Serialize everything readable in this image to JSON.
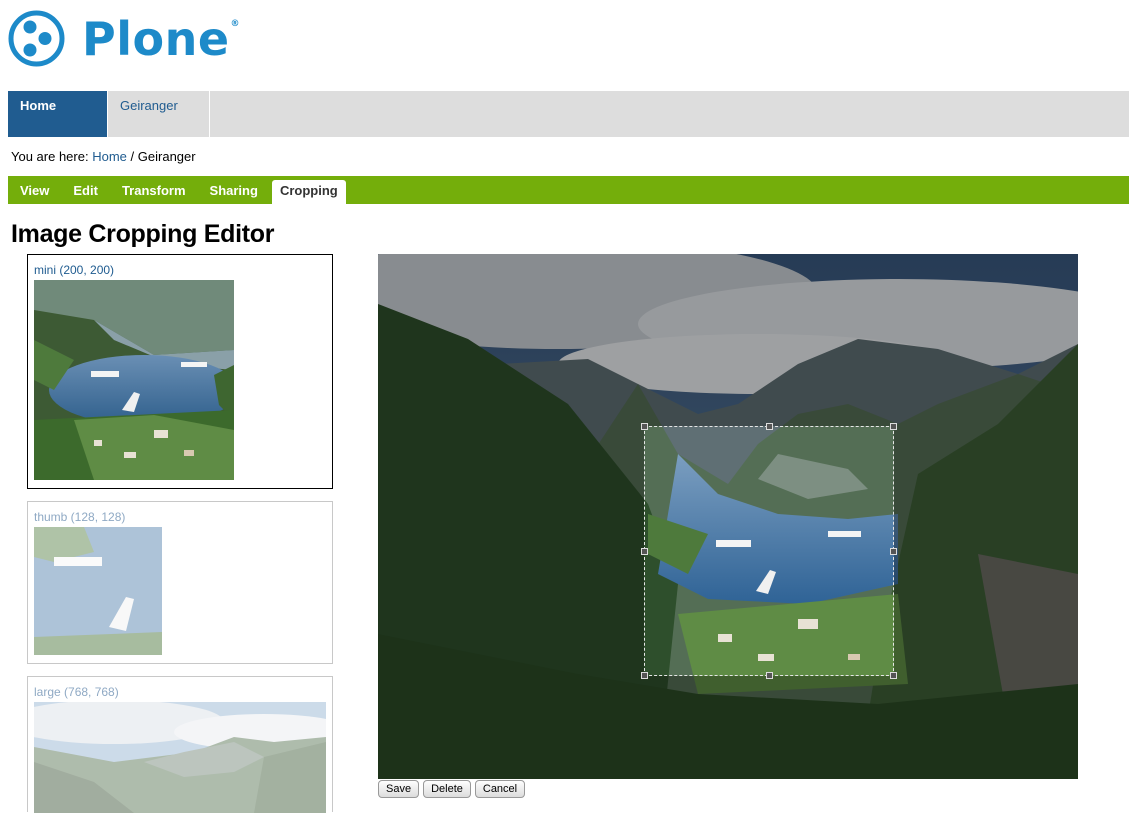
{
  "logo": {
    "text": "Plone",
    "reg": "®"
  },
  "portal_tabs": [
    {
      "label": "Home"
    },
    {
      "label": "Geiranger"
    }
  ],
  "breadcrumb": {
    "prefix": "You are here:",
    "home": "Home",
    "separator": "/",
    "current": "Geiranger"
  },
  "content_tabs": [
    "View",
    "Edit",
    "Transform",
    "Sharing",
    "Cropping"
  ],
  "page_title": "Image Cropping Editor",
  "scales": [
    {
      "label": "mini (200, 200)"
    },
    {
      "label": "thumb (128, 128)"
    },
    {
      "label": "large (768, 768)"
    }
  ],
  "buttons": {
    "save": "Save",
    "delete": "Delete",
    "cancel": "Cancel"
  },
  "colors": {
    "accent_blue": "#205c90",
    "logo_blue": "#1d8ac9",
    "content_tab_green": "#74ae0b"
  }
}
